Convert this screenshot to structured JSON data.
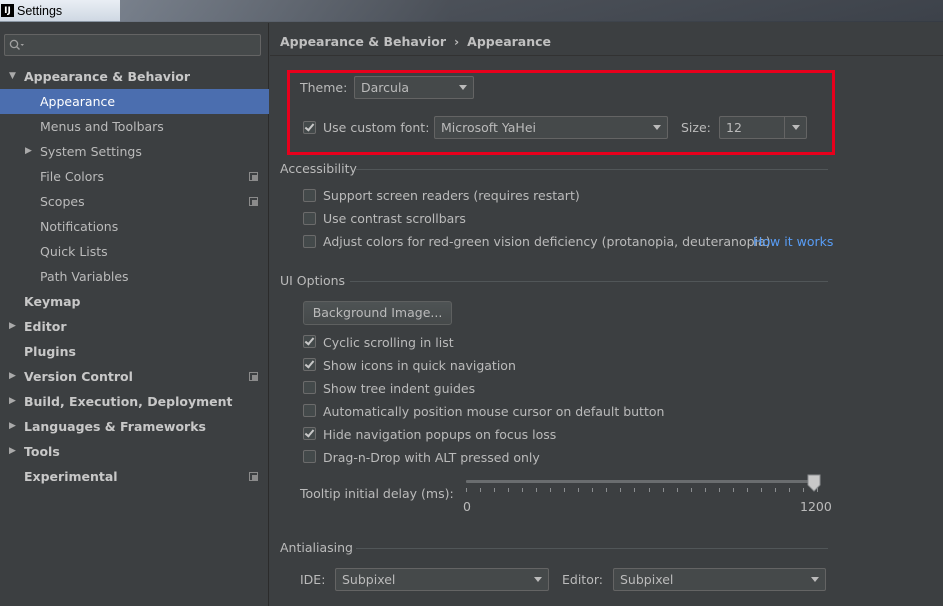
{
  "window": {
    "title": "Settings",
    "app_icon": "intellij-icon"
  },
  "search": {
    "placeholder": "",
    "icon": "search-icon"
  },
  "sidebar": {
    "items": [
      {
        "label": "Appearance & Behavior",
        "expanded": true
      },
      {
        "label": "Appearance"
      },
      {
        "label": "Menus and Toolbars"
      },
      {
        "label": "System Settings"
      },
      {
        "label": "File Colors"
      },
      {
        "label": "Scopes"
      },
      {
        "label": "Notifications"
      },
      {
        "label": "Quick Lists"
      },
      {
        "label": "Path Variables"
      },
      {
        "label": "Keymap"
      },
      {
        "label": "Editor"
      },
      {
        "label": "Plugins"
      },
      {
        "label": "Version Control"
      },
      {
        "label": "Build, Execution, Deployment"
      },
      {
        "label": "Languages & Frameworks"
      },
      {
        "label": "Tools"
      },
      {
        "label": "Experimental"
      }
    ],
    "selected": "Appearance"
  },
  "breadcrumb": {
    "parent": "Appearance & Behavior",
    "separator": "›",
    "current": "Appearance"
  },
  "theme": {
    "label": "Theme:",
    "value": "Darcula"
  },
  "font": {
    "checkbox_label": "Use custom font:",
    "checked": true,
    "value": "Microsoft YaHei",
    "size_label": "Size:",
    "size_value": "12"
  },
  "accessibility": {
    "title": "Accessibility",
    "options": [
      {
        "label": "Support screen readers (requires restart)",
        "checked": false
      },
      {
        "label": "Use contrast scrollbars",
        "checked": false
      },
      {
        "label": "Adjust colors for red-green vision deficiency (protanopia, deuteranopia)",
        "checked": false
      }
    ],
    "link": "How it works"
  },
  "ui_options": {
    "title": "UI Options",
    "background_button": "Background Image...",
    "options": [
      {
        "label": "Cyclic scrolling in list",
        "checked": true
      },
      {
        "label": "Show icons in quick navigation",
        "checked": true
      },
      {
        "label": "Show tree indent guides",
        "checked": false
      },
      {
        "label": "Automatically position mouse cursor on default button",
        "checked": false
      },
      {
        "label": "Hide navigation popups on focus loss",
        "checked": true
      },
      {
        "label": "Drag-n-Drop with ALT pressed only",
        "checked": false
      }
    ],
    "tooltip_delay": {
      "label": "Tooltip initial delay (ms):",
      "min": "0",
      "max": "1200",
      "value": 1200
    }
  },
  "antialiasing": {
    "title": "Antialiasing",
    "ide_label": "IDE:",
    "ide_value": "Subpixel",
    "editor_label": "Editor:",
    "editor_value": "Subpixel"
  },
  "colors": {
    "background": "#3c3f41",
    "selection": "#4b6eaf",
    "highlight": "#e8001c",
    "link": "#589df6"
  }
}
